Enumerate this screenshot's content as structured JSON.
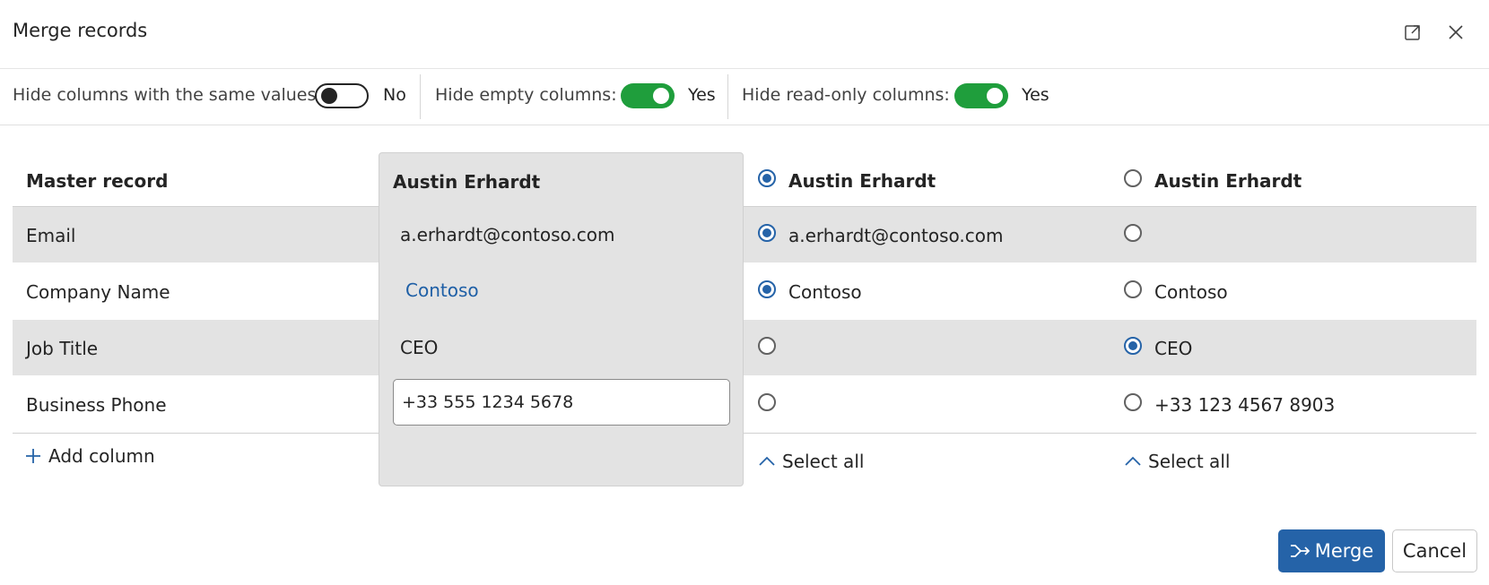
{
  "dialog": {
    "title": "Merge records"
  },
  "toolbar": {
    "same_values": {
      "label": "Hide columns with the same values:",
      "state": "No"
    },
    "empty": {
      "label": "Hide empty columns:",
      "state": "Yes"
    },
    "read_only": {
      "label": "Hide read-only columns:",
      "state": "Yes"
    }
  },
  "table": {
    "master_header": "Master record",
    "columns": [
      {
        "name": "Austin Erhardt"
      },
      {
        "name": "Austin Erhardt",
        "selected": true
      },
      {
        "name": "Austin Erhardt",
        "selected": false
      }
    ],
    "rows": [
      {
        "label": "Email",
        "master": "a.erhardt@contoso.com",
        "col2": "a.erhardt@contoso.com",
        "col2_selected": true,
        "col3": "",
        "col3_selected": false
      },
      {
        "label": "Company Name",
        "master": "Contoso",
        "col2": "Contoso",
        "col2_selected": true,
        "col3": "Contoso",
        "col3_selected": false
      },
      {
        "label": "Job Title",
        "master": "CEO",
        "col2": "",
        "col2_selected": false,
        "col3": "CEO",
        "col3_selected": true
      },
      {
        "label": "Business Phone",
        "master": "+33 555 1234 5678",
        "col2": "",
        "col2_selected": false,
        "col3": "+33 123 4567 8903",
        "col3_selected": false
      }
    ],
    "add_column_label": "Add column",
    "select_all_label": "Select all"
  },
  "actions": {
    "merge_label": "Merge",
    "cancel_label": "Cancel"
  },
  "colors": {
    "accent": "#2563a8",
    "toggle_on": "#1f9e3c"
  }
}
